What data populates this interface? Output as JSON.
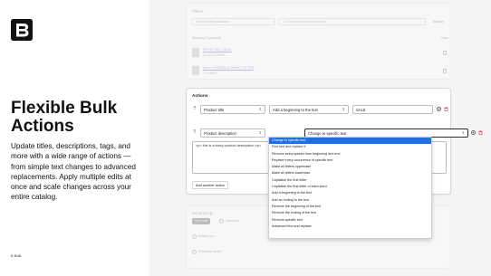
{
  "brand": {
    "headline": "Flexible Bulk Actions",
    "description": "Update titles, descriptions, tags, and more with a wide range of actions — from simple text changes to advanced replacements. Apply multiple edits at once and scale changes across your entire catalog.",
    "footer": "B Bulk"
  },
  "filters": {
    "title": "Filters",
    "selector_label": "Select products",
    "selector_prefix": "List by",
    "search_placeholder": "Search product and variants",
    "browse_label": "Browse",
    "selected_title": "Showing 2 products",
    "clear_label": "Clear",
    "products": [
      {
        "name": "PEPSI TAG | SINK",
        "sub": "ACCESSORIES"
      },
      {
        "name": "MAX | CROCKLE TANKT 70 TEE",
        "sub": "T-SHIRTS"
      }
    ]
  },
  "actions": {
    "title": "Actions",
    "rows": [
      {
        "field": "Product title",
        "operation": "Add a beginning to the text",
        "value": "SALE"
      },
      {
        "field": "Product description",
        "operation": "Change to specific text",
        "value": "<p> this is a fancy product description </p>"
      }
    ],
    "add_label": "Add another action"
  },
  "dropdown": {
    "options": [
      "Change to specific text",
      "Find text and replace it",
      "Remove extra spaces from beginning and end",
      "Replace every occurrence of specific text",
      "Make all letters uppercase",
      "Make all letters lowercase",
      "Capitalize the first letter",
      "Capitalize the first letter of each word",
      "Add a beginning to the text",
      "Add an ending to the text",
      "Remove the beginning of the text",
      "Remove the ending of the text",
      "Remove specific text",
      "Advanced find and replace"
    ],
    "selected_index": 0
  },
  "scheduling": {
    "title": "Scheduling",
    "run_now": "Run now",
    "schedule": "Schedule",
    "revert_label": "Revert run",
    "schedule_revert": "Schedule revert"
  },
  "colors": {
    "accent": "#1f6fe0",
    "link": "#5b4fd9",
    "delete": "#d62f3c"
  }
}
